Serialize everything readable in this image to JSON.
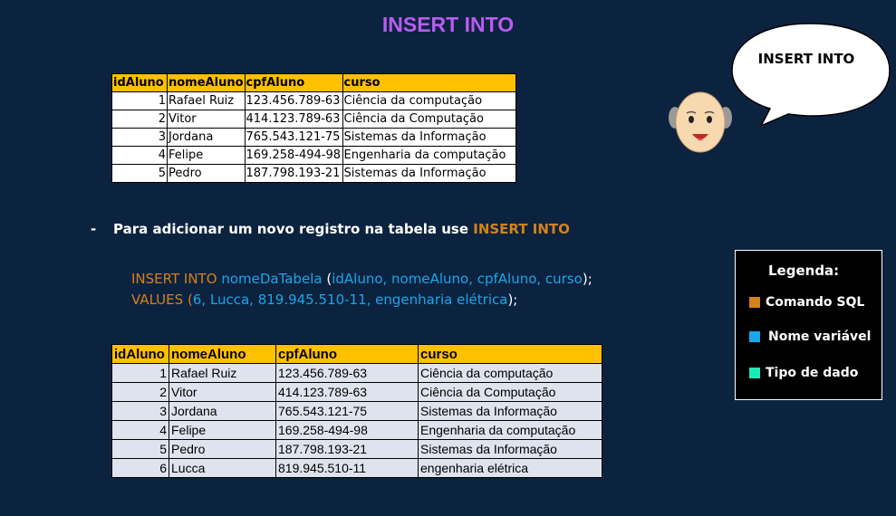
{
  "title": "INSERT INTO",
  "bubble_text": "INSERT INTO",
  "table1": {
    "headers": [
      "idAluno",
      "nomeAluno",
      "cpfAluno",
      "curso"
    ],
    "rows": [
      [
        "1",
        "Rafael Ruiz",
        "123.456.789-63",
        "Ciência da computação"
      ],
      [
        "2",
        "Vitor",
        "414.123.789-63",
        "Ciência da Computação"
      ],
      [
        "3",
        "Jordana",
        "765.543.121-75",
        "Sistemas da Informação"
      ],
      [
        "4",
        "Felipe",
        "169.258-494-98",
        "Engenharia da computação"
      ],
      [
        "5",
        "Pedro",
        "187.798.193-21",
        "Sistemas da Informação"
      ]
    ]
  },
  "bullet": {
    "dash": "-",
    "text": "Para adicionar um novo registro na tabela use ",
    "keyword": "INSERT INTO"
  },
  "code": {
    "line1": {
      "keyword": "INSERT INTO",
      "table": "nomeDaTabela",
      "open": "(",
      "columns": "idAluno, nomeAluno, cpfAluno, curso",
      "close": ");"
    },
    "line2": {
      "keyword": "VALUES",
      "open": "(",
      "values": "6, Lucca, 819.945.510-11, engenharia elétrica",
      "close": ");"
    }
  },
  "table2": {
    "headers": [
      "idAluno",
      "nomeAluno",
      "cpfAluno",
      "curso"
    ],
    "rows": [
      [
        "1",
        "Rafael Ruiz",
        "123.456.789-63",
        "Ciência da computação"
      ],
      [
        "2",
        "Vitor",
        "414.123.789-63",
        "Ciência da Computação"
      ],
      [
        "3",
        "Jordana",
        "765.543.121-75",
        "Sistemas da Informação"
      ],
      [
        "4",
        "Felipe",
        "169.258-494-98",
        "Engenharia da computação"
      ],
      [
        "5",
        "Pedro",
        "187.798.193-21",
        "Sistemas da Informação"
      ],
      [
        "6",
        "Lucca",
        "819.945.510-11",
        "engenharia elétrica"
      ]
    ]
  },
  "legend": {
    "title": "Legenda:",
    "items": [
      {
        "label": "Comando SQL",
        "color": "#d4821a"
      },
      {
        "label": "Nome variável",
        "color": "#1aa6e8"
      },
      {
        "label": "Tipo de dado",
        "color": "#1de9b6"
      }
    ]
  },
  "colors": {
    "background": "#0c2340",
    "title": "#b85cf0",
    "header": "#ffc000",
    "sql_command": "#d4821a",
    "variable_name": "#1aa6e8"
  }
}
